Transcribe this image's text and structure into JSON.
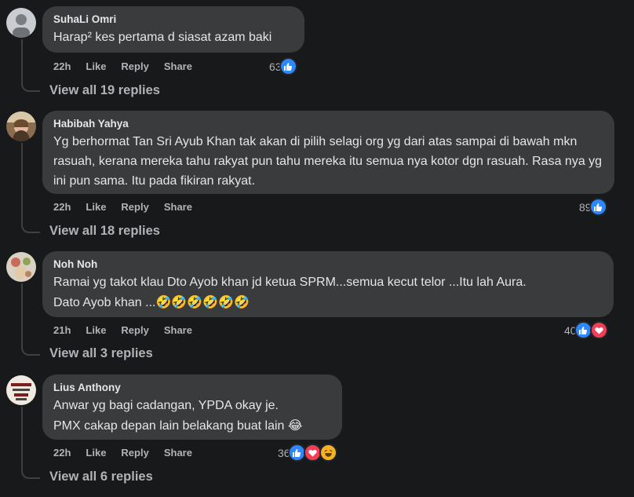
{
  "comments": [
    {
      "author": "SuhaLi Omri",
      "text": "Harap² kes pertama d siasat azam baki",
      "time": "22h",
      "like": "Like",
      "reply": "Reply",
      "share": "Share",
      "reaction_count": "63",
      "reactions": [
        "like-icon"
      ],
      "view_replies": "View all 19 replies"
    },
    {
      "author": "Habibah Yahya",
      "text": "Yg berhormat Tan Sri Ayub Khan tak akan di pilih selagi org yg dari atas sampai di bawah mkn rasuah, kerana mereka tahu rakyat pun tahu mereka itu semua nya kotor dgn rasuah. Rasa nya yg ini pun sama. Itu pada fikiran rakyat.",
      "time": "22h",
      "like": "Like",
      "reply": "Reply",
      "share": "Share",
      "reaction_count": "89",
      "reactions": [
        "like-icon"
      ],
      "view_replies": "View all 18 replies"
    },
    {
      "author": "Noh Noh",
      "text_line1": "Ramai yg takot klau Dto Ayob khan jd ketua SPRM...semua kecut telor ...Itu lah Aura.",
      "text_line2": "Dato Ayob khan ...🤣🤣🤣🤣🤣🤣",
      "time": "21h",
      "like": "Like",
      "reply": "Reply",
      "share": "Share",
      "reaction_count": "40",
      "reactions": [
        "like-icon",
        "love-icon"
      ],
      "view_replies": "View all 3 replies"
    },
    {
      "author": "Lius Anthony",
      "text_line1": "Anwar yg bagi cadangan, YPDA okay je.",
      "text_line2": "PMX cakap depan lain belakang buat lain 😂",
      "time": "22h",
      "like": "Like",
      "reply": "Reply",
      "share": "Share",
      "reaction_count": "36",
      "reactions": [
        "like-icon",
        "love-icon",
        "haha-icon"
      ],
      "view_replies": "View all 6 replies"
    }
  ],
  "colors": {
    "background": "#18191a",
    "bubble": "#3a3b3c",
    "text": "#e4e6eb",
    "muted": "#b0b3b8",
    "like": "#2d88ff",
    "love": "#f33e58",
    "haha": "#f7b125"
  }
}
